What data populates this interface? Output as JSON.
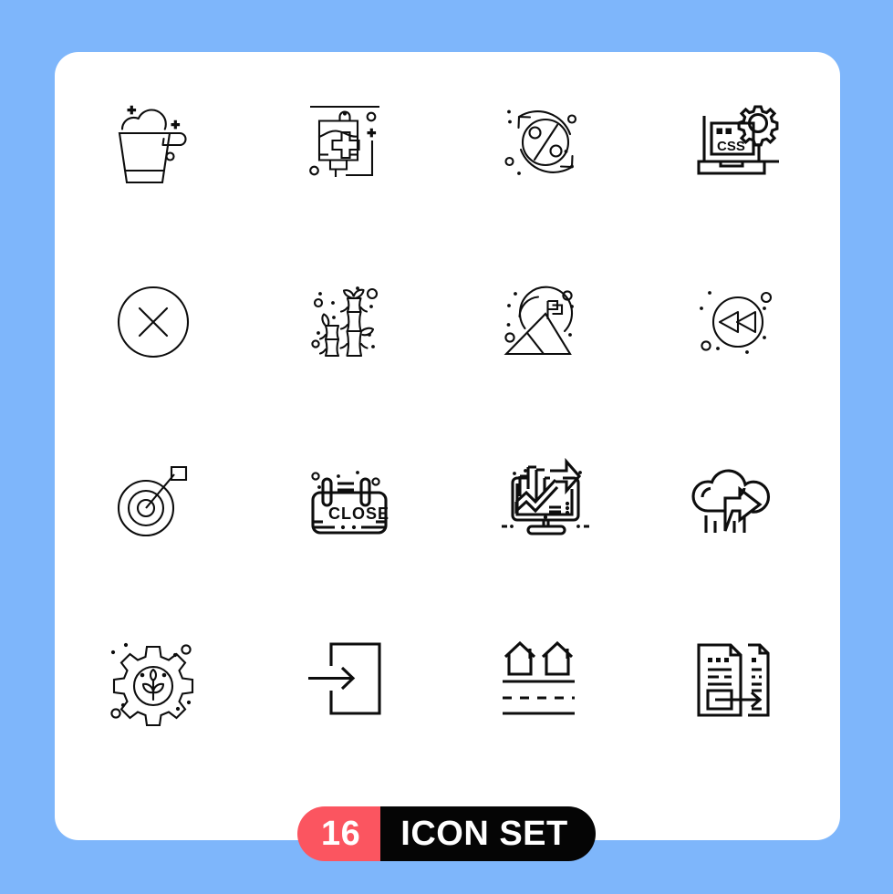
{
  "canvas": {
    "background_color": "#7eb6fb",
    "card_color": "#ffffff"
  },
  "badge": {
    "count": "16",
    "label": "ICON SET",
    "count_bg": "#fb5560",
    "label_bg": "#050505",
    "text_color": "#ffffff"
  },
  "grid": {
    "columns": 4,
    "rows": 4,
    "stroke_color": "#0d0d0d",
    "style": "outline"
  },
  "icons": [
    {
      "name": "bucket-foam-icon",
      "label": "Bucket"
    },
    {
      "name": "iv-drip-bag-icon",
      "label": "Blood Bag"
    },
    {
      "name": "percentage-refresh-icon",
      "label": "Discount Refresh"
    },
    {
      "name": "laptop-css-gear-icon",
      "label": "CSS",
      "text": "CSS"
    },
    {
      "name": "close-circle-x-icon",
      "label": "Cancel"
    },
    {
      "name": "bamboo-plant-icon",
      "label": "Bamboo"
    },
    {
      "name": "mountain-flag-icon",
      "label": "Summit"
    },
    {
      "name": "rewind-circle-icon",
      "label": "Rewind"
    },
    {
      "name": "target-dart-icon",
      "label": "Target"
    },
    {
      "name": "close-sign-icon",
      "label": "Close Sign",
      "text": "CLOSE"
    },
    {
      "name": "monitor-growth-chart-icon",
      "label": "Analytics"
    },
    {
      "name": "cloud-lightning-arrow-icon",
      "label": "Storm"
    },
    {
      "name": "gear-sprout-icon",
      "label": "Eco Settings"
    },
    {
      "name": "login-arrow-icon",
      "label": "Login"
    },
    {
      "name": "houses-road-icon",
      "label": "Neighborhood"
    },
    {
      "name": "file-transfer-icon",
      "label": "File Transfer"
    }
  ]
}
